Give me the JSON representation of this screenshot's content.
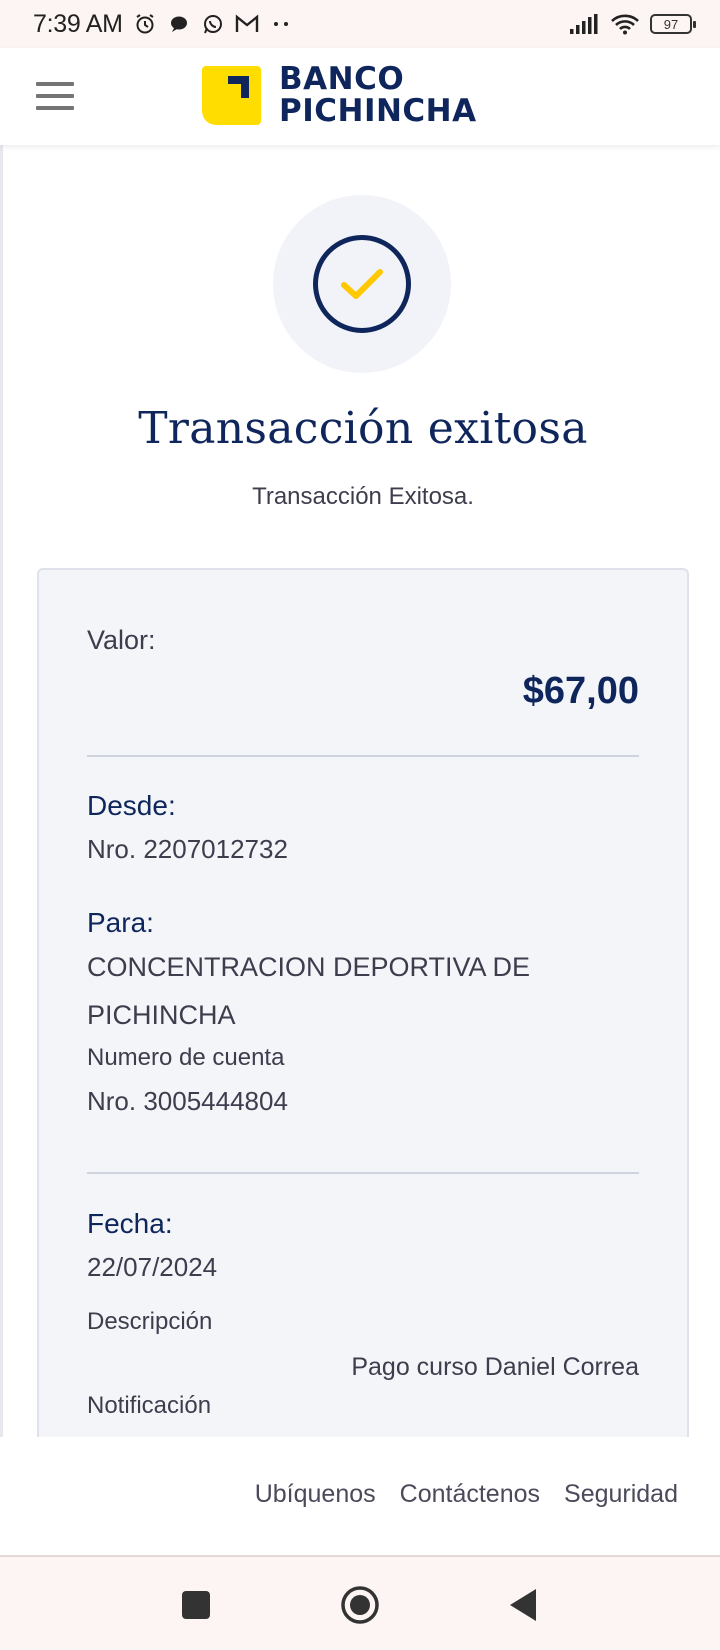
{
  "status_bar": {
    "time": "7:39 AM",
    "battery": "97",
    "icons": [
      "alarm-icon",
      "chat-icon",
      "whatsapp-icon",
      "gmail-icon",
      "more-dots-icon",
      "signal-icon",
      "wifi-icon",
      "battery-icon"
    ]
  },
  "header": {
    "logo_line1": "BANCO",
    "logo_line2": "PICHINCHA",
    "menu_icon": "hamburger-icon"
  },
  "main": {
    "title": "Transacción exitosa",
    "subtitle": "Transacción Exitosa.",
    "success_icon": "check-circle-icon",
    "colors": {
      "primary": "#0f265c",
      "accent": "#ffd200",
      "card_bg": "#f4f5f9"
    }
  },
  "details": {
    "valor_label": "Valor:",
    "valor_amount": "$67,00",
    "desde_label": "Desde:",
    "desde_value": "Nro. 2207012732",
    "para_label": "Para:",
    "para_name_line1": "CONCENTRACION DEPORTIVA DE",
    "para_name_line2": "PICHINCHA",
    "account_label": "Numero de cuenta",
    "account_value": "Nro. 3005444804",
    "fecha_label": "Fecha:",
    "fecha_value": "22/07/2024",
    "descripcion_label": "Descripción",
    "descripcion_value": "Pago curso Daniel Correa",
    "notificacion_label": "Notificación"
  },
  "footer": {
    "links": [
      "Ubíquenos",
      "Contáctenos",
      "Seguridad"
    ]
  },
  "nav_bar": {
    "icons": [
      "recents-icon",
      "home-icon",
      "back-icon"
    ]
  }
}
